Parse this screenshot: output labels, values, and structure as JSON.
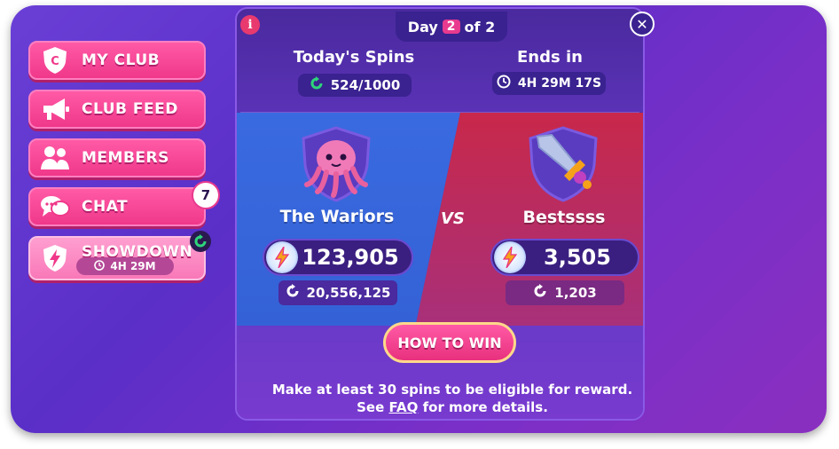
{
  "sidebar": {
    "items": [
      {
        "label": "MY CLUB",
        "icon": "club-shield-icon"
      },
      {
        "label": "CLUB FEED",
        "icon": "megaphone-icon"
      },
      {
        "label": "MEMBERS",
        "icon": "members-icon"
      },
      {
        "label": "CHAT",
        "icon": "chat-bubbles-icon",
        "badge": "7"
      },
      {
        "label": "SHOWDOWN",
        "icon": "showdown-shield-icon",
        "timer": "4H 29M"
      }
    ]
  },
  "header": {
    "day_prefix": "Day",
    "day_number": "2",
    "day_suffix": "of 2",
    "info": "i",
    "close": "✕"
  },
  "stats": {
    "spins_title": "Today's Spins",
    "spins_value": "524/1000",
    "ends_title": "Ends in",
    "ends_value": "4H 29M 17S"
  },
  "teams": {
    "left": {
      "name": "The Wariors",
      "score": "123,905",
      "spins": "20,556,125",
      "mascot": "octopus-icon"
    },
    "right": {
      "name": "Bestssss",
      "score": "3,505",
      "spins": "1,203",
      "mascot": "sword-icon"
    },
    "vs": "VS"
  },
  "cta": {
    "label": "HOW TO WIN"
  },
  "footer": {
    "line1": "Make at least 30 spins to be eligible for reward.",
    "line2_pre": "See",
    "faq": "FAQ",
    "line2_post": "for more details."
  },
  "colors": {
    "accent_pink": "#f0388a",
    "team_blue": "#3a6ae0",
    "team_red": "#c8284a",
    "panel": "#5230b0"
  }
}
